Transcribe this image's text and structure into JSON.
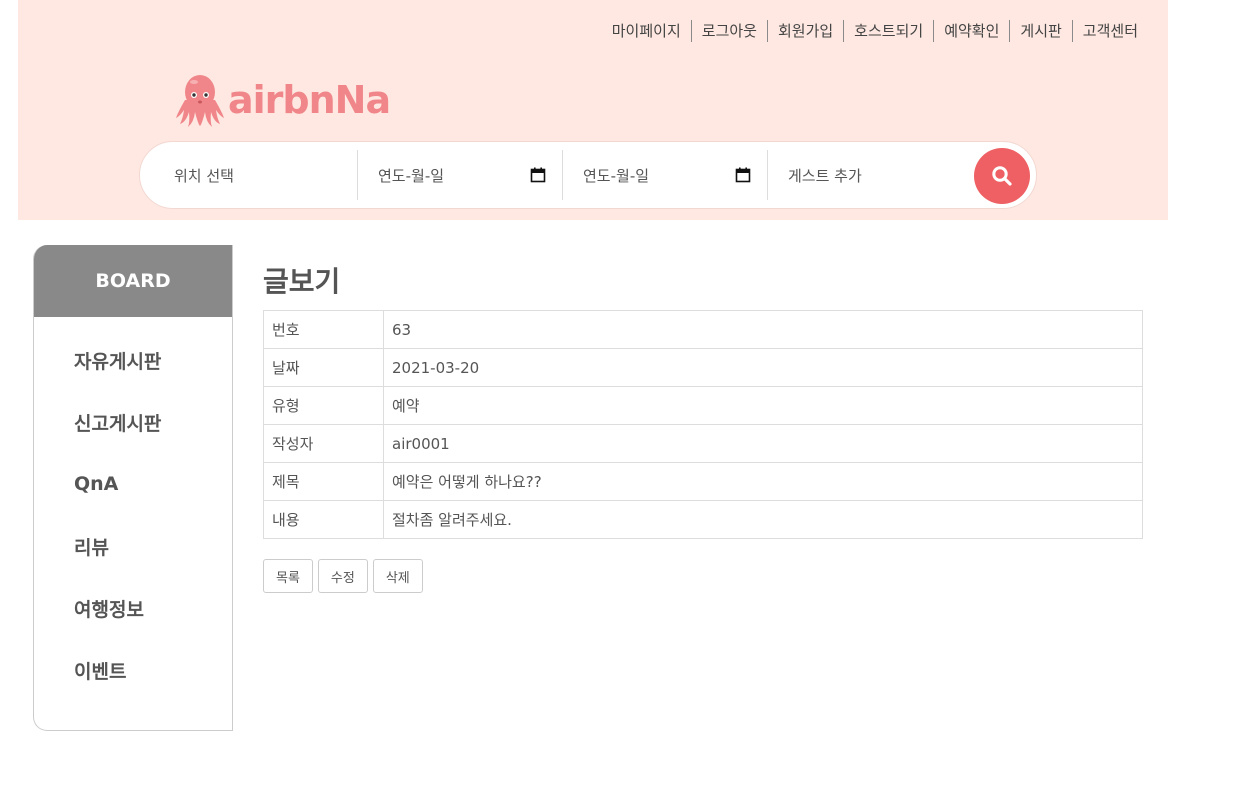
{
  "topnav": {
    "items": [
      "마이페이지",
      "로그아웃",
      "회원가입",
      "호스트되기",
      "예약확인",
      "게시판",
      "고객센터"
    ]
  },
  "brand": {
    "name": "airbnNa",
    "color": "#f0868a"
  },
  "search": {
    "location_placeholder": "위치 선택",
    "checkin_text": "연도-월-일",
    "checkout_text": "연도-월-일",
    "guest_placeholder": "게스트 추가",
    "button_icon": "search-icon",
    "button_color": "#ee6063"
  },
  "sidebar": {
    "title": "BOARD",
    "items": [
      "자유게시판",
      "신고게시판",
      "QnA",
      "리뷰",
      "여행정보",
      "이벤트"
    ]
  },
  "post": {
    "page_title": "글보기",
    "rows": [
      {
        "label": "번호",
        "value": "63"
      },
      {
        "label": "날짜",
        "value": "2021-03-20"
      },
      {
        "label": "유형",
        "value": "예약"
      },
      {
        "label": "작성자",
        "value": "air0001"
      },
      {
        "label": "제목",
        "value": "예약은 어떻게 하나요??"
      },
      {
        "label": "내용",
        "value": "절차좀 알려주세요."
      }
    ]
  },
  "actions": {
    "list_label": "목록",
    "edit_label": "수정",
    "delete_label": "삭제"
  },
  "colors": {
    "header_bg": "#fee8e1",
    "sidebar_head_bg": "#898989"
  }
}
